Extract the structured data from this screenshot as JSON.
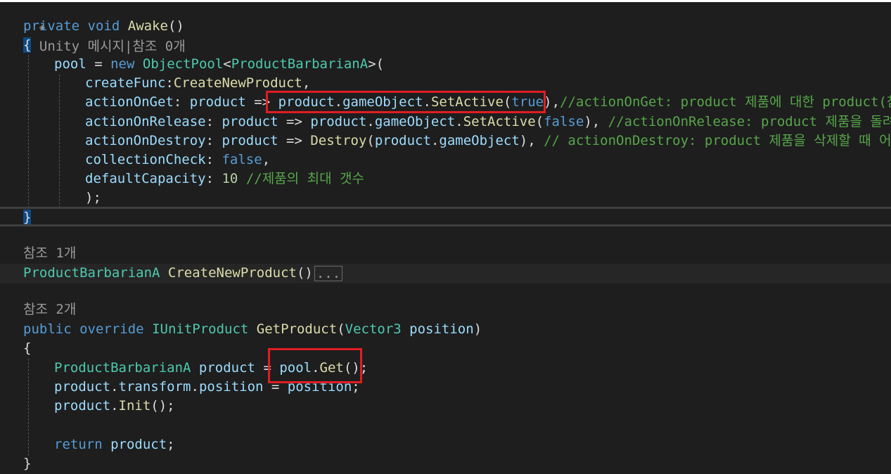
{
  "lens_unity": "Unity 메시지|참조 0개",
  "awake": {
    "line1_kw1": "private",
    "line1_kw2": "void",
    "line1_name": "Awake",
    "line1_paren": "()",
    "open_brace": "{",
    "pool_var": "pool",
    "eq": " = ",
    "new_kw": "new",
    "pool_type": "ObjectPool",
    "lt": "<",
    "generic_type": "ProductBarbarianA",
    "gt_paren": ">(",
    "create_param": "createFunc",
    "create_colon": ":",
    "create_value": "CreateNewProduct",
    "comma": ",",
    "get_param": "actionOnGet",
    "lambda_var": "product",
    "arrow": " => ",
    "get_expr_obj": "product",
    "dot": ".",
    "get_expr_go": "gameObject",
    "get_expr_method": "SetActive",
    "get_expr_arg": "true",
    "get_comment": "//actionOnGet: product 제품에 대한 product(참",
    "release_param": "actionOnRelease",
    "release_arg": "false",
    "release_comment": "//actionOnRelease: product 제품을 돌려",
    "destroy_param": "actionOnDestroy",
    "destroy_method": "Destroy",
    "destroy_comment": "// actionOnDestroy: product 제품을 삭제할 때 어",
    "check_param": "collectionCheck",
    "check_value": "false",
    "capacity_param": "defaultCapacity",
    "capacity_value": "10",
    "capacity_comment": "//제품의 최대 갯수",
    "close_call": ");",
    "close_brace": "}"
  },
  "create": {
    "lens": "참조 1개",
    "return_type": "ProductBarbarianA",
    "name": "CreateNewProduct",
    "paren": "()",
    "collapsed": "..."
  },
  "getproduct": {
    "lens": "참조 2개",
    "kw1": "public",
    "kw2": "override",
    "return_type": "IUnitProduct",
    "name": "GetProduct",
    "open": "(",
    "param_type": "Vector3",
    "param_name": "position",
    "close": ")",
    "open_brace": "{",
    "local_type": "ProductBarbarianA",
    "local_var": "product",
    "pool": "pool",
    "get_method": "Get",
    "get_end": "();",
    "transform": "transform",
    "position": "position",
    "init": "Init",
    "init_end": "();",
    "return_kw": "return",
    "return_val": "product",
    "semicolon": ";",
    "close_brace": "}"
  }
}
